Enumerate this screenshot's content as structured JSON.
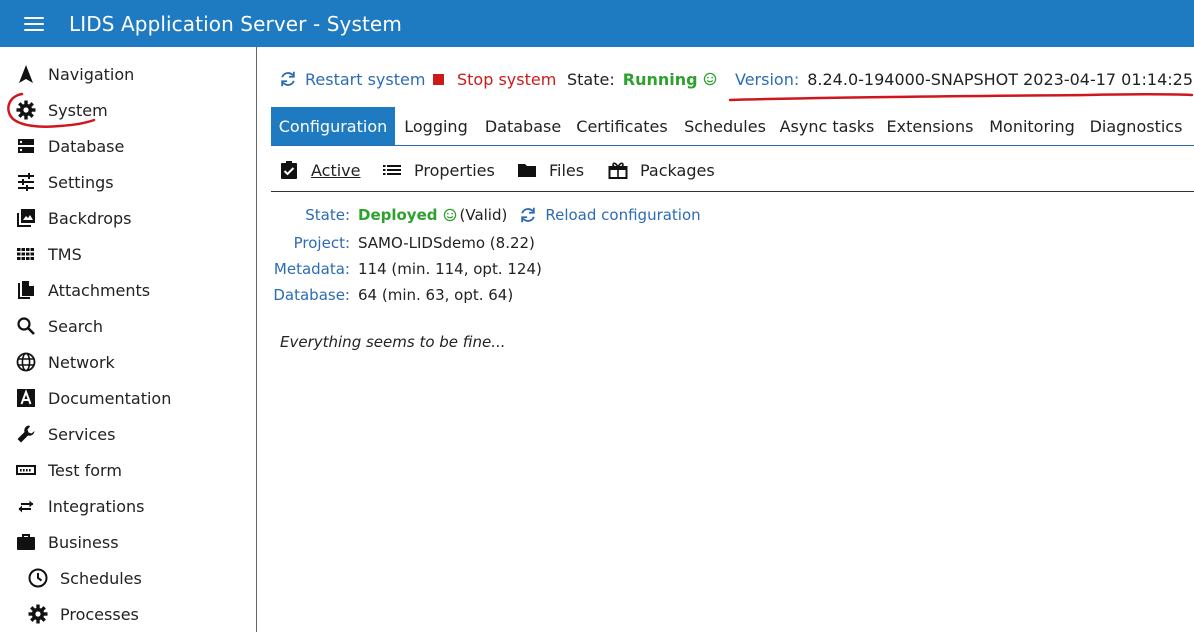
{
  "header": {
    "title": "LIDS Application Server - System"
  },
  "sidebar": {
    "items": [
      {
        "label": "Navigation",
        "icon": "navigation-arrow-icon"
      },
      {
        "label": "System",
        "icon": "gear-icon"
      },
      {
        "label": "Database",
        "icon": "database-icon"
      },
      {
        "label": "Settings",
        "icon": "sliders-icon"
      },
      {
        "label": "Backdrops",
        "icon": "image-stack-icon"
      },
      {
        "label": "TMS",
        "icon": "grid-icon"
      },
      {
        "label": "Attachments",
        "icon": "attachment-icon"
      },
      {
        "label": "Search",
        "icon": "search-icon"
      },
      {
        "label": "Network",
        "icon": "globe-icon"
      },
      {
        "label": "Documentation",
        "icon": "doc-letter-icon"
      },
      {
        "label": "Services",
        "icon": "wrench-icon"
      },
      {
        "label": "Test form",
        "icon": "form-icon"
      },
      {
        "label": "Integrations",
        "icon": "swap-arrows-icon"
      },
      {
        "label": "Business",
        "icon": "briefcase-icon"
      },
      {
        "label": "Schedules",
        "icon": "clock-icon"
      },
      {
        "label": "Processes",
        "icon": "gear-icon"
      }
    ]
  },
  "toolbar": {
    "restart_label": "Restart system",
    "stop_label": "Stop system",
    "state_label": "State:",
    "state_value": "Running",
    "version_label": "Version:",
    "version_value": "8.24.0-194000-SNAPSHOT 2023-04-17 01:14:25"
  },
  "tabs": [
    "Configuration",
    "Logging",
    "Database",
    "Certificates",
    "Schedules",
    "Async tasks",
    "Extensions",
    "Monitoring",
    "Diagnostics"
  ],
  "subtabs": [
    "Active",
    "Properties",
    "Files",
    "Packages"
  ],
  "info": {
    "state_label": "State:",
    "state_value": "Deployed",
    "state_extra": "(Valid)",
    "reload_label": "Reload configuration",
    "project_label": "Project:",
    "project_value": "SAMO-LIDSdemo (8.22)",
    "metadata_label": "Metadata:",
    "metadata_value": "114 (min. 114, opt. 124)",
    "database_label": "Database:",
    "database_value": "64 (min. 63, opt. 64)"
  },
  "status_message": "Everything seems to be fine...",
  "colors": {
    "header": "#1f7bc1",
    "link": "#2d6bb5",
    "stop": "#cc1a1a",
    "ok": "#2ea12e",
    "annotation": "#d0161d"
  }
}
